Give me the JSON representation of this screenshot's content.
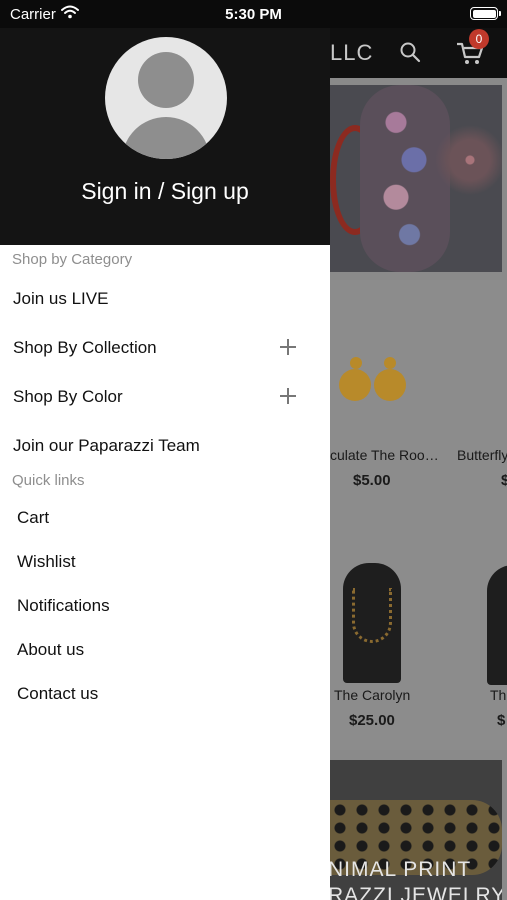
{
  "status_bar": {
    "carrier": "Carrier",
    "time": "5:30 PM"
  },
  "background_app": {
    "title": "LLC",
    "cart_count": "0",
    "products": [
      {
        "name": "culate The Roo…",
        "price": "$5.00"
      },
      {
        "name": "Butterfly",
        "price": "$"
      },
      {
        "name": "The Carolyn",
        "price": "$25.00"
      },
      {
        "name": "Th",
        "price": "$"
      }
    ],
    "bottom_banner": {
      "line1": "NIMAL PRINT",
      "line2": "RAZZI JEWELRY"
    }
  },
  "drawer": {
    "sign_in": "Sign in / Sign up",
    "shop_label": "Shop by Category",
    "categories": [
      {
        "label": "Join us LIVE"
      },
      {
        "label": "Shop By Collection"
      },
      {
        "label": "Shop By Color"
      },
      {
        "label": "Join our Paparazzi Team"
      }
    ],
    "quick_label": "Quick links",
    "quick_links": [
      {
        "label": "Cart"
      },
      {
        "label": "Wishlist"
      },
      {
        "label": "Notifications"
      },
      {
        "label": "About us"
      },
      {
        "label": "Contact us"
      }
    ]
  }
}
